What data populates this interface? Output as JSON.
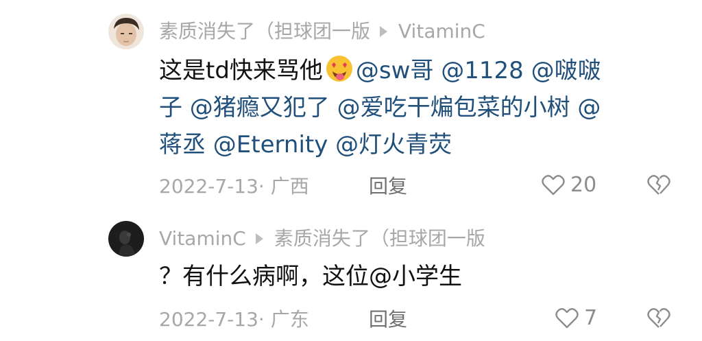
{
  "comments": [
    {
      "author": "素质消失了（担球团一版",
      "reply_to": "VitaminC",
      "text_lines": [
        {
          "segments": [
            {
              "text": "这是td快来骂他",
              "mention": false
            },
            {
              "emoji": "star-struck-tongue-emoji"
            },
            {
              "text": "@sw哥 @1128 @啵啵",
              "mention": true
            }
          ]
        },
        {
          "segments": [
            {
              "text": "子 @猪瘾又犯了 @爱吃干煸包菜的小树 @",
              "mention": true
            }
          ]
        },
        {
          "segments": [
            {
              "text": "蒋丞 @Eternity @灯火青荧",
              "mention": true
            }
          ]
        }
      ],
      "date_location": "2022-7-13· 广西",
      "reply_label": "回复",
      "like_count": "20"
    },
    {
      "author": "VitaminC",
      "reply_to": "素质消失了（担球团一版",
      "text_lines": [
        {
          "segments": [
            {
              "text": "？有什么病啊，这位",
              "mention": false
            },
            {
              "text": "@小学生",
              "mention": false
            }
          ]
        }
      ],
      "date_location": "2022-7-13· 广东",
      "reply_label": "回复",
      "like_count": "7"
    }
  ],
  "colors": {
    "meta": "#a7a7a7",
    "mention": "#1f4f7a",
    "body_text": "#111111"
  }
}
